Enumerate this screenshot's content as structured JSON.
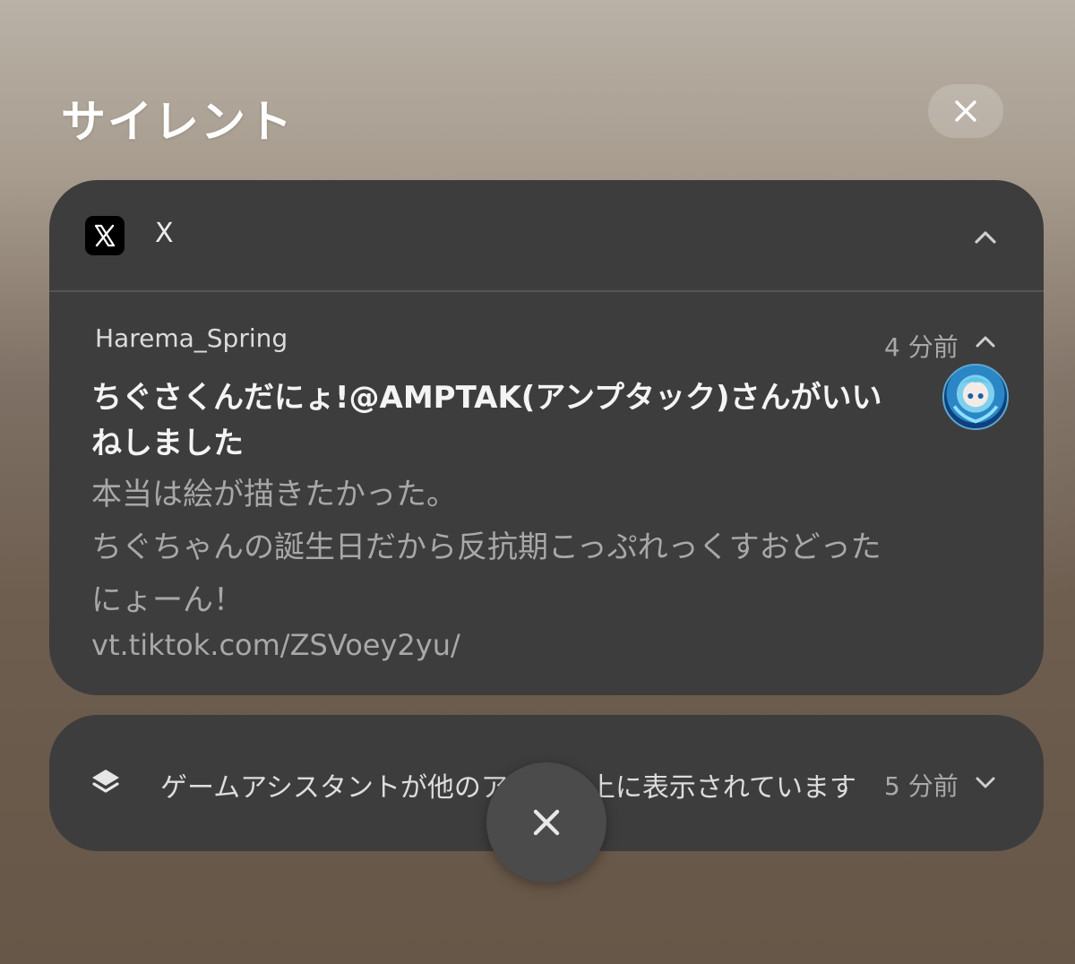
{
  "section": {
    "title": "サイレント",
    "close_icon": "close-icon"
  },
  "app_group": {
    "app_name": "X",
    "app_icon": "x-logo-icon",
    "collapse_icon": "chevron-up-icon"
  },
  "notification": {
    "sender": "Harema_Spring",
    "time": "4 分前",
    "title": "ちぐさくんだにょ!@AMPTAK(アンプタック)さんがいいねしました",
    "body_lines": [
      "本当は絵が描きたかった。",
      "ちぐちゃんの誕生日だから反抗期こっぷれっくすおどった",
      "にょーん！"
    ],
    "link": "vt.tiktok.com/ZSVoey2yu/",
    "collapse_icon": "chevron-up-icon",
    "avatar": "avatar"
  },
  "game_notification": {
    "icon": "layers-icon",
    "text": "ゲームアシスタントが他のアプリの上に表示されています",
    "time": "5 分前",
    "expand_icon": "chevron-down-icon"
  },
  "dismiss_all": {
    "icon": "close-icon"
  },
  "colors": {
    "card_bg": "#3d3d3d",
    "primary_text": "#f4f4f4",
    "secondary_text": "#a8a8a8",
    "dismiss_bg": "#4b4b4b"
  }
}
